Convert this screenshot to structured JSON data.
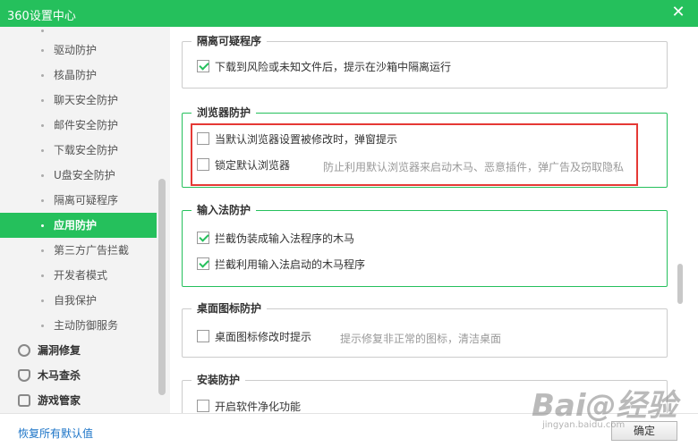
{
  "window": {
    "title": "360设置中心",
    "close_glyph": "✕"
  },
  "sidebar": {
    "sub_items": [
      {
        "label": "驱动防护"
      },
      {
        "label": "核晶防护"
      },
      {
        "label": "聊天安全防护"
      },
      {
        "label": "邮件安全防护"
      },
      {
        "label": "下载安全防护"
      },
      {
        "label": "U盘安全防护"
      },
      {
        "label": "隔离可疑程序"
      },
      {
        "label": "应用防护",
        "active": true
      },
      {
        "label": "第三方广告拦截"
      },
      {
        "label": "开发者模式"
      },
      {
        "label": "自我保护"
      },
      {
        "label": "主动防御服务"
      }
    ],
    "categories": [
      {
        "label": "漏洞修复",
        "icon": "repair-icon"
      },
      {
        "label": "木马查杀",
        "icon": "shield-icon"
      },
      {
        "label": "游戏管家",
        "icon": "gamepad-icon"
      }
    ]
  },
  "groups": {
    "isolate": {
      "title": "隔离可疑程序",
      "option": "下载到风险或未知文件后，提示在沙箱中隔离运行",
      "checked": true
    },
    "browser": {
      "title": "浏览器防护",
      "option1": "当默认浏览器设置被修改时，弹窗提示",
      "option1_checked": false,
      "option2": "锁定默认浏览器",
      "option2_checked": false,
      "option2_desc": "防止利用默认浏览器来启动木马、恶意插件，弹广告及窃取隐私"
    },
    "ime": {
      "title": "输入法防护",
      "option1": "拦截伪装成输入法程序的木马",
      "option1_checked": true,
      "option2": "拦截利用输入法启动的木马程序",
      "option2_checked": true
    },
    "desktop": {
      "title": "桌面图标防护",
      "option": "桌面图标修改时提示",
      "checked": false,
      "desc": "提示修复非正常的图标，清洁桌面"
    },
    "install": {
      "title": "安装防护",
      "option": "开启软件净化功能",
      "checked": false
    }
  },
  "footer": {
    "restore_label": "恢复所有默认值",
    "ok_label": "确定"
  },
  "watermark": {
    "text": "Bai@经验",
    "sub": "jingyan.baidu.com"
  },
  "colors": {
    "accent": "#25c05c",
    "highlight": "#e53935",
    "link": "#1a73c7"
  }
}
